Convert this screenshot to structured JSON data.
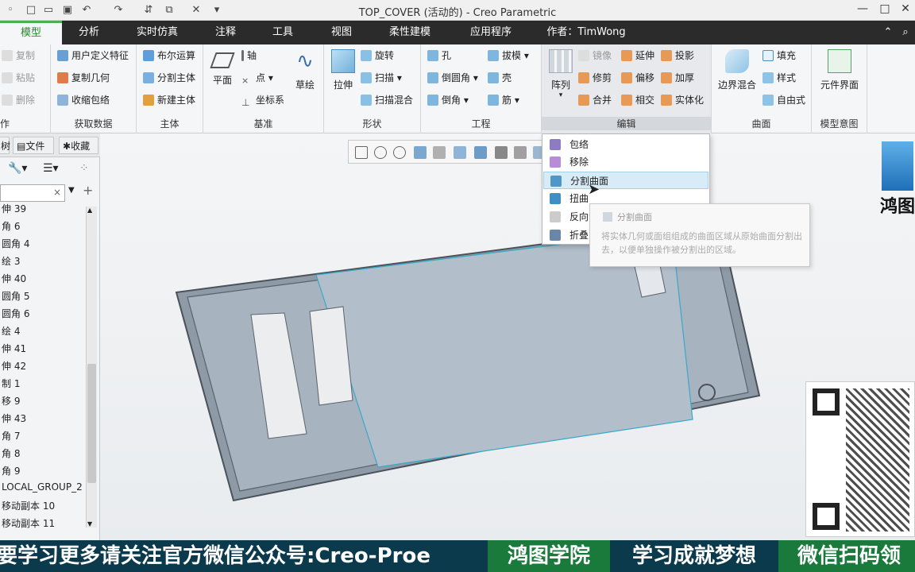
{
  "window": {
    "title": "TOP_COVER (活动的) - Creo Parametric"
  },
  "tabs": [
    "模型",
    "分析",
    "实时仿真",
    "注释",
    "工具",
    "视图",
    "柔性建模",
    "应用程序",
    "作者：TimWong"
  ],
  "ribbon": {
    "operations": {
      "label": "作",
      "items": [
        "复制",
        "粘贴",
        "删除"
      ]
    },
    "get_data": {
      "label": "获取数据",
      "items": [
        "用户定义特征",
        "复制几何",
        "收缩包络"
      ]
    },
    "body": {
      "label": "主体",
      "items": [
        "布尔运算",
        "分割主体",
        "新建主体"
      ]
    },
    "datum": {
      "label": "基准",
      "plane": "平面",
      "items": [
        "轴",
        "点",
        "坐标系"
      ],
      "sketch": "草绘"
    },
    "shapes": {
      "label": "形状",
      "extrude": "拉伸",
      "items": [
        "旋转",
        "扫描",
        "扫描混合"
      ]
    },
    "engineering": {
      "label": "工程",
      "col1": [
        "孔",
        "倒圆角",
        "倒角"
      ],
      "col2": [
        "拔模",
        "壳",
        "筋"
      ]
    },
    "editing": {
      "label": "编辑",
      "pattern": "阵列",
      "col1": [
        "镜像",
        "修剪",
        "合并"
      ],
      "col2": [
        "延伸",
        "偏移",
        "相交"
      ],
      "col3": [
        "投影",
        "加厚",
        "实体化"
      ]
    },
    "surfaces": {
      "label": "曲面",
      "boundary": "边界混合",
      "items": [
        "填充",
        "样式",
        "自由式"
      ]
    },
    "model_intent": {
      "label": "模型意图",
      "component": "元件界面"
    }
  },
  "left_panel": {
    "tabs": [
      "树",
      "文件",
      "收藏"
    ],
    "tree_items": [
      "伸 39",
      "角 6",
      "圆角 4",
      "绘 3",
      "伸 40",
      "圆角 5",
      "圆角 6",
      "绘 4",
      "伸 41",
      "伸 42",
      "制 1",
      "移 9",
      "伸 43",
      "角 7",
      "角 8",
      "角 9",
      "LOCAL_GROUP_2",
      "移动副本 10",
      "移动副本 11"
    ]
  },
  "dropdown": {
    "items": [
      "包络",
      "移除",
      "分割曲面",
      "扭曲",
      "反向法向",
      "折叠"
    ],
    "highlighted": "分割曲面",
    "tooltip_title": "分割曲面",
    "tooltip_text": "将实体几何或面组组成的曲面区域从原始曲面分割出去，以便单独操作被分割出的区域。"
  },
  "watermark": {
    "text": "鸿图"
  },
  "banner": {
    "segments": [
      "要学习更多请关注官方微信公众号:Creo-Proe",
      "鸿图学院",
      "学习成就梦想",
      "微信扫码领"
    ]
  },
  "colors": {
    "tab_bar": "#2b2b2b",
    "accent": "#4caf50",
    "banner": "#0b3a4d",
    "banner_accent": "#1a7a3c"
  }
}
